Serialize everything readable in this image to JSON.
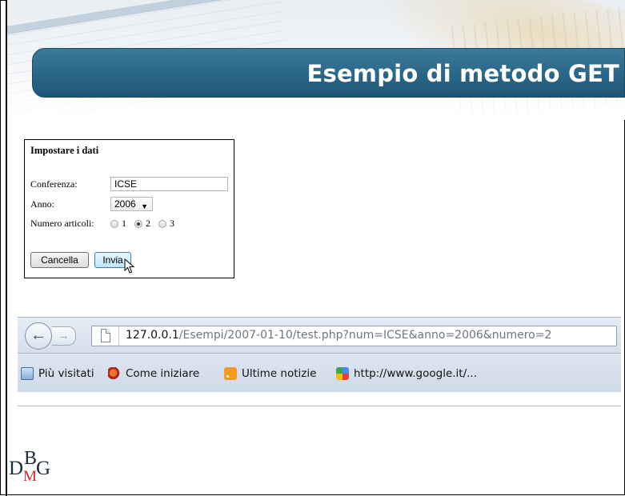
{
  "slide": {
    "title": "Esempio di metodo GET"
  },
  "form": {
    "heading": "Impostare i dati",
    "conference_label": "Conferenza:",
    "conference_value": "ICSE",
    "year_label": "Anno:",
    "year_selected": "2006",
    "articles_label": "Numero articoli:",
    "articles_options": [
      "1",
      "2",
      "3"
    ],
    "articles_selected": "2",
    "cancel_label": "Cancella",
    "submit_label": "Invia"
  },
  "browser": {
    "url_host": "127.0.0.1",
    "url_path": "/Esempi/2007-01-10/test.php?num=ICSE&anno=2006&numero=2",
    "bookmarks": [
      {
        "label": "Più visitati",
        "icon": "magnifier-icon"
      },
      {
        "label": "Come iniziare",
        "icon": "firefox-icon"
      },
      {
        "label": "Ultime notizie",
        "icon": "rss-icon"
      },
      {
        "label": "http://www.google.it/...",
        "icon": "google-icon"
      }
    ]
  },
  "logo": {
    "d": "D",
    "b": "B",
    "m": "M",
    "g": "G"
  },
  "colors": {
    "title_bar": "#2a6688",
    "logo_accent": "#c9262e"
  }
}
